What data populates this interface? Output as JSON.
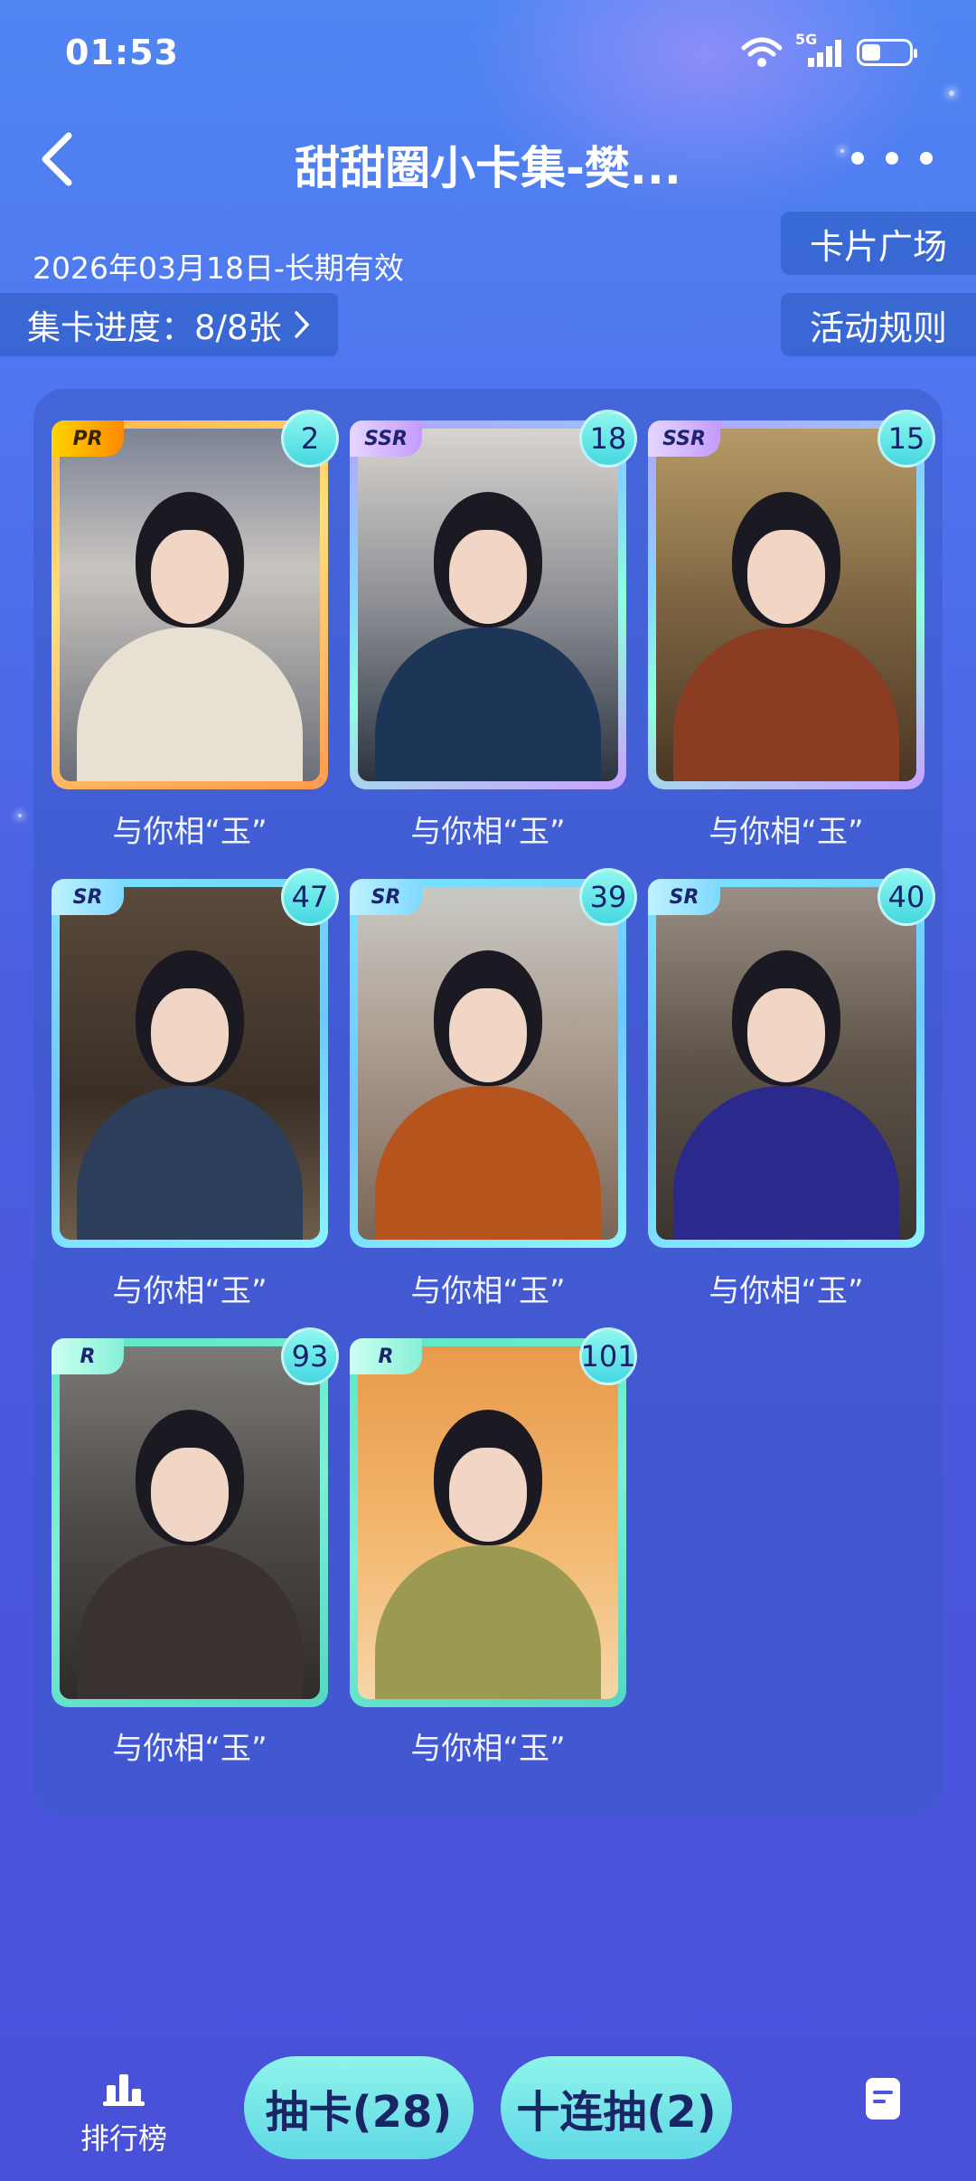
{
  "status_bar": {
    "time": "01:53",
    "network": "5G"
  },
  "header": {
    "title": "甜甜圈小卡集-樊..."
  },
  "info": {
    "date_range": "2026年03月18日-长期有效",
    "progress_text": "集卡进度：8/8张",
    "card_square": "卡片广场",
    "rules": "活动规则"
  },
  "cards": [
    {
      "rarity": "PR",
      "count": "2",
      "name": "与你相“玉”"
    },
    {
      "rarity": "SSR",
      "count": "18",
      "name": "与你相“玉”"
    },
    {
      "rarity": "SSR",
      "count": "15",
      "name": "与你相“玉”"
    },
    {
      "rarity": "SR",
      "count": "47",
      "name": "与你相“玉”"
    },
    {
      "rarity": "SR",
      "count": "39",
      "name": "与你相“玉”"
    },
    {
      "rarity": "SR",
      "count": "40",
      "name": "与你相“玉”"
    },
    {
      "rarity": "R",
      "count": "93",
      "name": "与你相“玉”"
    },
    {
      "rarity": "R",
      "count": "101",
      "name": "与你相“玉”"
    }
  ],
  "bottom_bar": {
    "ranking": "排行榜",
    "draw_button": "抽卡(28)",
    "ten_draw_button": "十连抽(2)"
  },
  "colors": {
    "accent": "#5fd8e6",
    "panel": "#3c5ac8",
    "background": "#4a55dc"
  }
}
